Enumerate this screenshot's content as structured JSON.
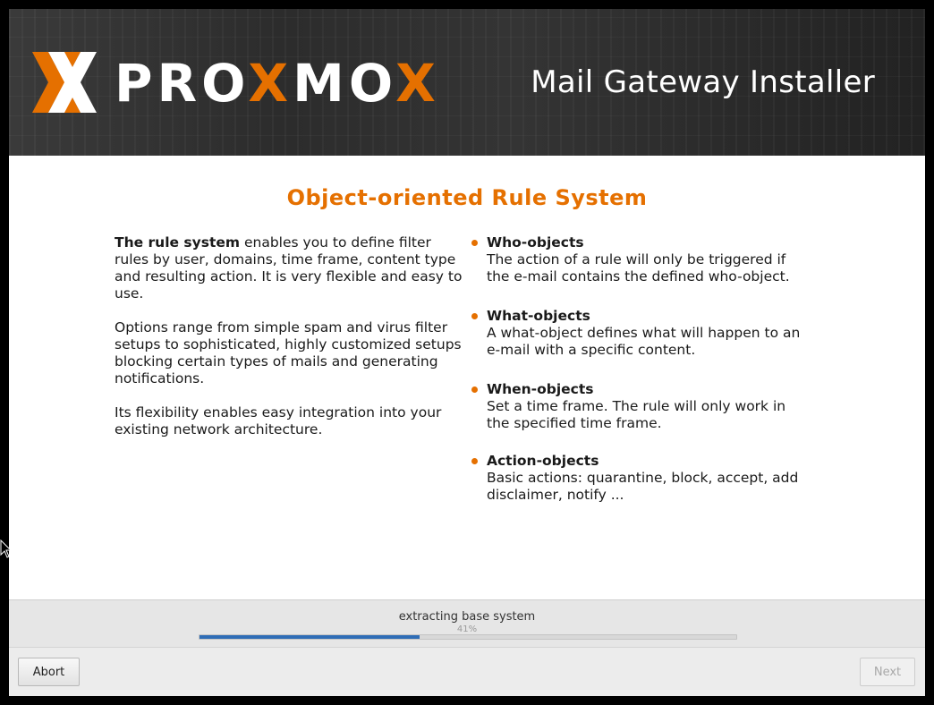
{
  "header": {
    "brand": "PROXMOX",
    "product": "Mail Gateway Installer"
  },
  "content": {
    "title": "Object-oriented Rule System",
    "intro_bold": "The rule system",
    "intro_rest": " enables you to define filter rules by user, domains, time frame, content type and resulting action. It is very flexible and easy to use.",
    "paragraph2": "Options range from simple spam and virus filter setups to sophisticated, highly customized setups blocking certain types of mails and generating notifications.",
    "paragraph3": "Its flexibility enables easy integration into your existing network architecture.",
    "features": [
      {
        "title": "Who-objects",
        "desc": "The action of a rule will only be triggered if the e-mail contains the defined who-object."
      },
      {
        "title": "What-objects",
        "desc": "A what-object defines what will happen to an e-mail with a specific content."
      },
      {
        "title": "When-objects",
        "desc": "Set a time frame. The rule will only work in the specified time frame."
      },
      {
        "title": "Action-objects",
        "desc": "Basic actions: quarantine, block, accept, add disclaimer, notify ..."
      }
    ]
  },
  "progress": {
    "status": "extracting base system",
    "percent_label": "41%",
    "value": 0.41
  },
  "buttons": {
    "abort": "Abort",
    "next": "Next"
  },
  "colors": {
    "accent": "#e57000",
    "progress": "#2f6db6"
  },
  "icons": {
    "logo": "proxmox-x-logo",
    "cursor": "mouse-pointer-icon"
  }
}
